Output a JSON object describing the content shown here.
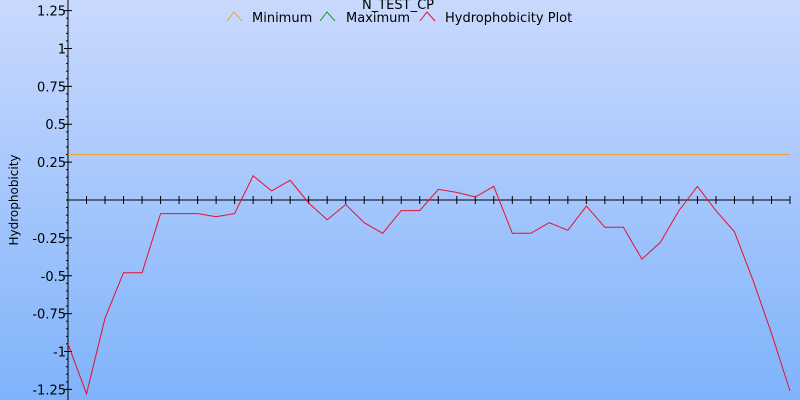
{
  "chart_data": {
    "type": "line",
    "title": "N_TEST_CP",
    "ylabel": "Hydrophobicity",
    "xlabel": "",
    "ylim": [
      -1.32,
      1.32
    ],
    "yticks": [
      1.25,
      1,
      0.75,
      0.5,
      0.25,
      -0.25,
      -0.5,
      -0.75,
      -1,
      -1.25
    ],
    "ytick_labels": [
      "1.25",
      "1",
      "0.75",
      "0.5",
      "0.25",
      "-0.25",
      "-0.5",
      "-0.75",
      "-1",
      "-1.25"
    ],
    "x": [
      0,
      1,
      2,
      3,
      4,
      5,
      6,
      7,
      8,
      9,
      10,
      11,
      12,
      13,
      14,
      15,
      16,
      17,
      18,
      19,
      20,
      21,
      22,
      23,
      24,
      25,
      26,
      27,
      27.7,
      28,
      29,
      30,
      31,
      32,
      33,
      34,
      35,
      36,
      37,
      38,
      39,
      40,
      41
    ],
    "legend": [
      "Minimum",
      "Maximum",
      "Hydrophobicity Plot"
    ],
    "series": [
      {
        "name": "Minimum",
        "color": "#e8a33c",
        "x": [
          0,
          41
        ],
        "values": [
          0.3,
          0.3
        ]
      },
      {
        "name": "Maximum",
        "color": "#1a9a1a",
        "x": [],
        "values": []
      },
      {
        "name": "Hydrophobicity Plot",
        "color": "#e8102c",
        "values": [
          -0.95,
          -1.28,
          -0.78,
          -0.48,
          -0.48,
          -0.09,
          -0.09,
          -0.09,
          -0.11,
          -0.09,
          0.16,
          0.06,
          0.13,
          -0.02,
          -0.13,
          -0.03,
          -0.15,
          -0.22,
          -0.07,
          -0.07,
          0.07,
          0.05,
          0.02,
          0.09,
          -0.22,
          -0.22,
          -0.15,
          -0.2,
          -0.04,
          -0.18,
          -0.18,
          -0.39,
          -0.28,
          -0.07,
          0.09,
          -0.07,
          -0.21,
          -0.53,
          -0.88,
          -1.26
        ]
      }
    ],
    "grid": false,
    "legend_position": "top-center"
  }
}
